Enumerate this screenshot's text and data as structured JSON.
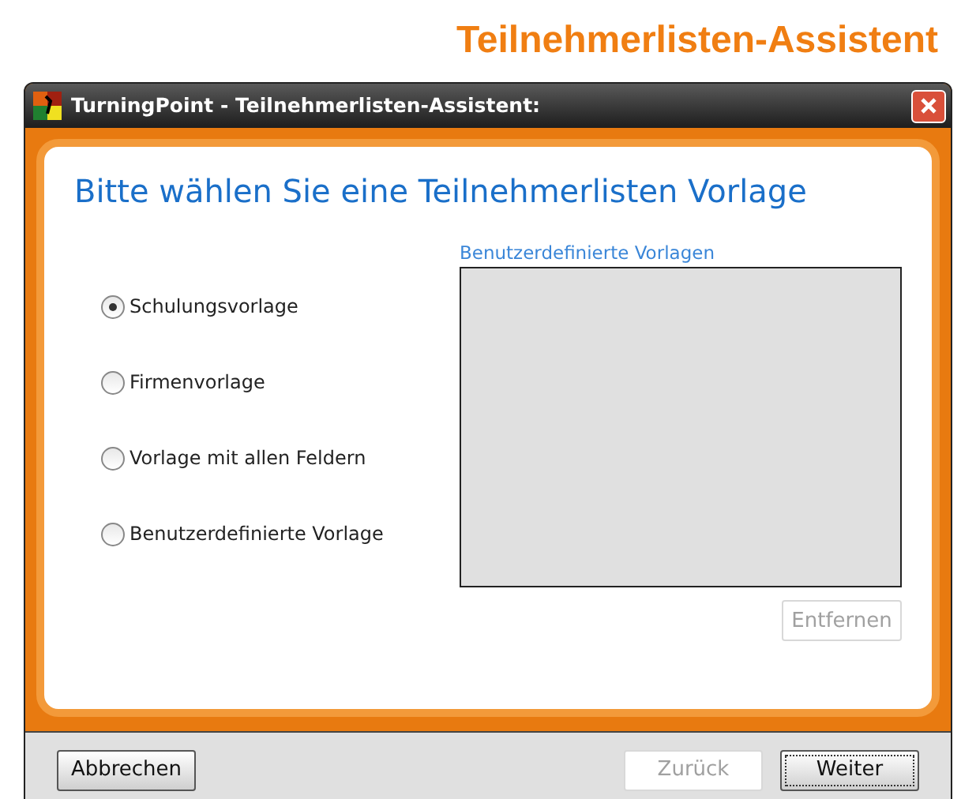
{
  "page_title": "Teilnehmerlisten-Assistent",
  "window": {
    "title": "TurningPoint - Teilnehmerlisten-Assistent:"
  },
  "heading": "Bitte wählen Sie eine Teilnehmerlisten Vorlage",
  "options": [
    {
      "label": "Schulungsvorlage",
      "selected": true
    },
    {
      "label": "Firmenvorlage",
      "selected": false
    },
    {
      "label": "Vorlage mit allen Feldern",
      "selected": false
    },
    {
      "label": "Benutzerdefinierte Vorlage",
      "selected": false
    }
  ],
  "custom_templates": {
    "label": "Benutzerdefinierte Vorlagen",
    "remove_button": {
      "label": "Entfernen",
      "disabled": true
    }
  },
  "buttons": [
    {
      "label": "Abbrechen",
      "disabled": false,
      "default": false
    },
    {
      "label": "Zurück",
      "disabled": true,
      "default": false
    },
    {
      "label": "Weiter",
      "disabled": false,
      "default": true
    }
  ]
}
